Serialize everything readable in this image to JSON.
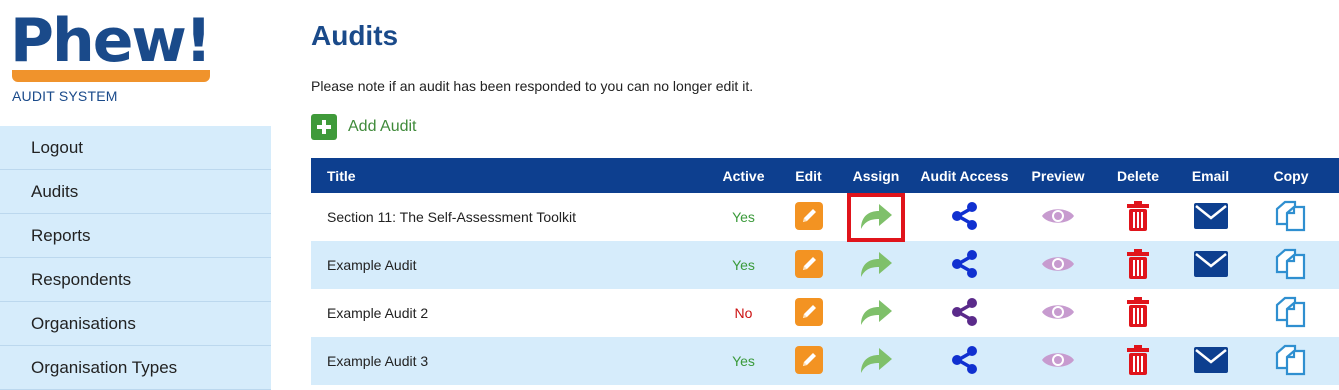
{
  "logo": {
    "word": "Phew!",
    "subtitle": "AUDIT SYSTEM"
  },
  "nav": [
    {
      "label": "Logout"
    },
    {
      "label": "Audits"
    },
    {
      "label": "Reports"
    },
    {
      "label": "Respondents"
    },
    {
      "label": "Organisations"
    },
    {
      "label": "Organisation Types"
    }
  ],
  "page": {
    "title": "Audits",
    "note": "Please note if an audit has been responded to you can no longer edit it.",
    "add_label": "Add Audit"
  },
  "table": {
    "headers": [
      "Title",
      "Active",
      "Edit",
      "Assign",
      "Audit Access",
      "Preview",
      "Delete",
      "Email",
      "Copy"
    ],
    "rows": [
      {
        "title": "Section 11: The Self-Assessment Toolkit",
        "active": "Yes",
        "share_color": "#1030d0",
        "has_email": true,
        "assign_highlighted": true
      },
      {
        "title": "Example Audit",
        "active": "Yes",
        "share_color": "#1030d0",
        "has_email": true,
        "assign_highlighted": false
      },
      {
        "title": "Example Audit 2",
        "active": "No",
        "share_color": "#5a2a8a",
        "has_email": false,
        "assign_highlighted": false
      },
      {
        "title": "Example Audit 3",
        "active": "Yes",
        "share_color": "#1030d0",
        "has_email": true,
        "assign_highlighted": false
      }
    ]
  },
  "icons": {
    "edit": "pencil-icon",
    "assign": "forward-arrow-icon",
    "access": "share-icon",
    "preview": "eye-icon",
    "delete": "trash-icon",
    "email": "envelope-icon",
    "copy": "copy-icon"
  },
  "colors": {
    "brand_blue": "#1a4a8a",
    "header_blue": "#0d3f8f",
    "row_alt": "#d6ecfb",
    "edit_orange": "#f39322",
    "assign_green": "#7fc06a",
    "preview_pink": "#c79bcf",
    "delete_red": "#e0141b",
    "email_blue": "#0d3f8f",
    "copy_blue": "#2f8fd0",
    "highlight_red": "#e0141b"
  }
}
